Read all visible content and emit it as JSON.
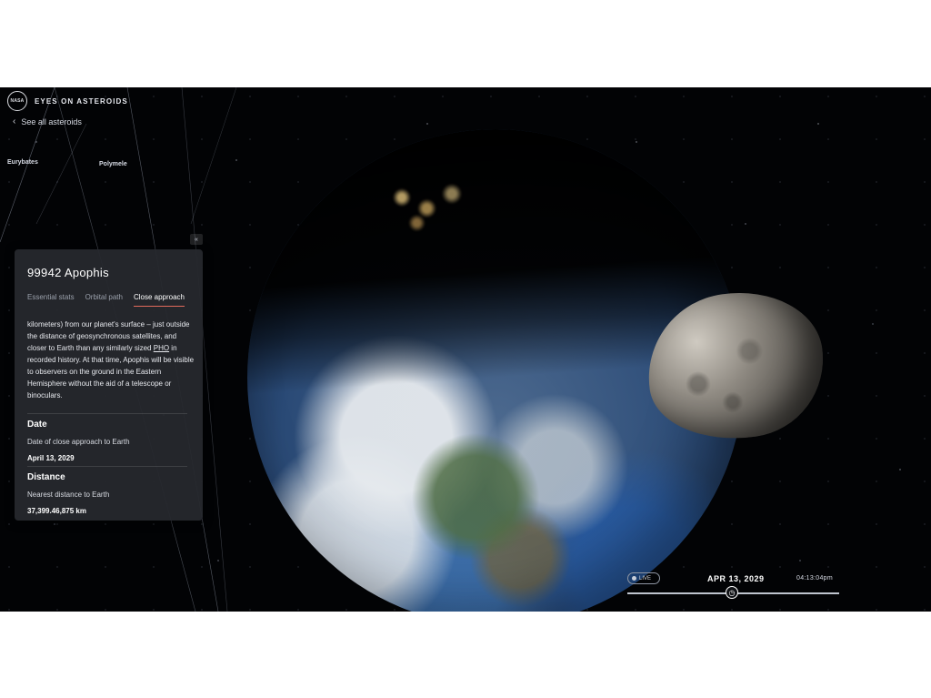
{
  "header": {
    "logo_text": "NASA",
    "app_title": "EYES ON ASTEROIDS",
    "back_label": "See all asteroids"
  },
  "scene_labels": [
    "Eurybates",
    "Polymele"
  ],
  "panel": {
    "title": "99942 Apophis",
    "tabs": [
      {
        "label": "Essential stats",
        "active": false
      },
      {
        "label": "Orbital path",
        "active": false
      },
      {
        "label": "Close approach",
        "active": true
      }
    ],
    "body_before": "kilometers) from our planet's surface – just outside the distance of geosynchronous satellites, and closer to Earth than any similarly sized ",
    "body_link": "PHO",
    "body_after": " in recorded history. At that time, Apophis will be visible to observers on the ground in the Eastern Hemisphere without the aid of a telescope or binoculars.",
    "sections": [
      {
        "heading": "Date",
        "label": "Date of close approach to Earth",
        "value": "April 13, 2029"
      },
      {
        "heading": "Distance",
        "label": "Nearest distance to Earth",
        "value": "37,399.46,875 km"
      }
    ]
  },
  "timeline": {
    "live_label": "LIVE",
    "date": "APR 13, 2029",
    "time": "04:13:04pm"
  },
  "icons": {
    "back": "chevron-left-icon",
    "collapse": "double-chevron-left-icon",
    "timeline_handle": "clock-icon"
  },
  "colors": {
    "space_background": "#020305",
    "panel_background": "#26282e",
    "active_tab_accent": "#e26a5c"
  }
}
